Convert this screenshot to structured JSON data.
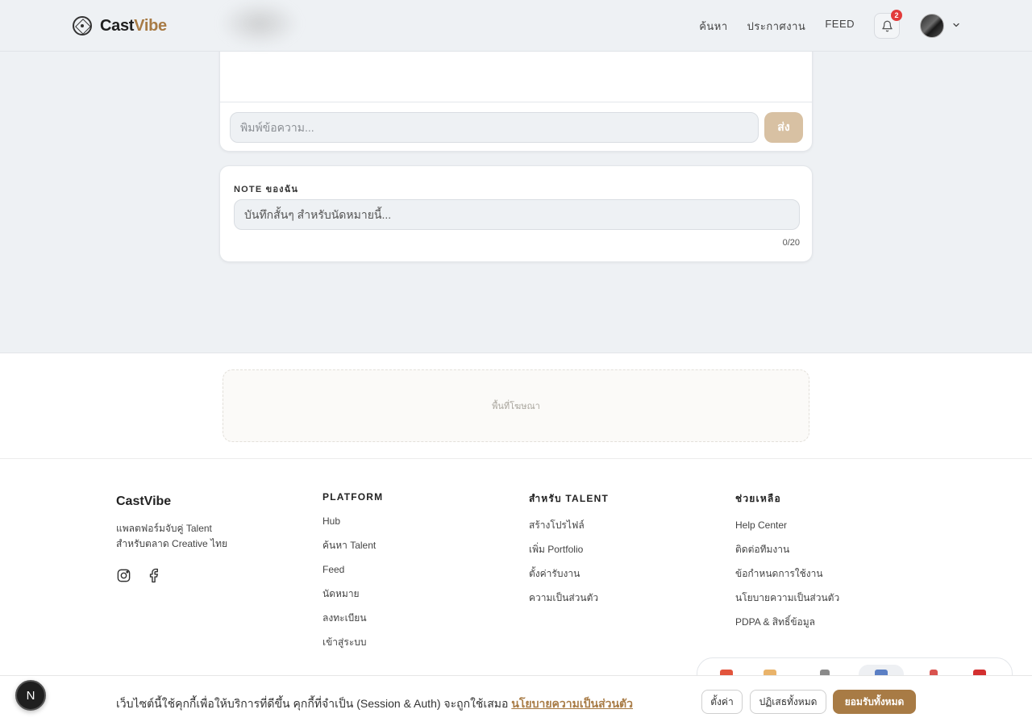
{
  "header": {
    "logo_main": "Cast",
    "logo_accent": "Vibe",
    "nav": [
      "ค้นหา",
      "ประกาศงาน",
      "FEED"
    ],
    "notification_count": "2"
  },
  "chat": {
    "placeholder": "พิมพ์ข้อความ...",
    "send_label": "ส่ง"
  },
  "note": {
    "label": "NOTE ของฉัน",
    "placeholder": "บันทึกสั้นๆ สำหรับนัดหมายนี้...",
    "counter": "0/20"
  },
  "ad": {
    "label": "พื้นที่โฆษณา"
  },
  "footer": {
    "brand": "CastVibe",
    "tagline_line1": "แพลตฟอร์มจับคู่ Talent",
    "tagline_line2": "สำหรับตลาด Creative ไทย",
    "columns": [
      {
        "title": "PLATFORM",
        "links": [
          "Hub",
          "ค้นหา Talent",
          "Feed",
          "นัดหมาย",
          "ลงทะเบียน",
          "เข้าสู่ระบบ"
        ]
      },
      {
        "title": "สำหรับ TALENT",
        "links": [
          "สร้างโปรไฟล์",
          "เพิ่ม Portfolio",
          "ตั้งค่ารับงาน",
          "ความเป็นส่วนตัว"
        ]
      },
      {
        "title": "ช่วยเหลือ",
        "links": [
          "Help Center",
          "ติดต่อทีมงาน",
          "ข้อกำหนดการใช้งาน",
          "นโยบายความเป็นส่วนตัว",
          "PDPA & สิทธิ์ข้อมูล"
        ]
      }
    ]
  },
  "cookie": {
    "text": "เว็บไซต์นี้ใช้คุกกี้เพื่อให้บริการที่ดีขึ้น คุกกี้ที่จำเป็น (Session & Auth) จะถูกใช้เสมอ ",
    "policy_link": "นโยบายความเป็นส่วนตัว",
    "settings_label": "ตั้งค่า",
    "reject_label": "ปฏิเสธทั้งหมด",
    "accept_label": "ยอมรับทั้งหมด"
  },
  "dev_badge": "N",
  "colors": {
    "accent": "#a87b45",
    "send_button": "#d8c1a3",
    "badge": "#e23b3b",
    "page_bg": "#eef1f4"
  }
}
